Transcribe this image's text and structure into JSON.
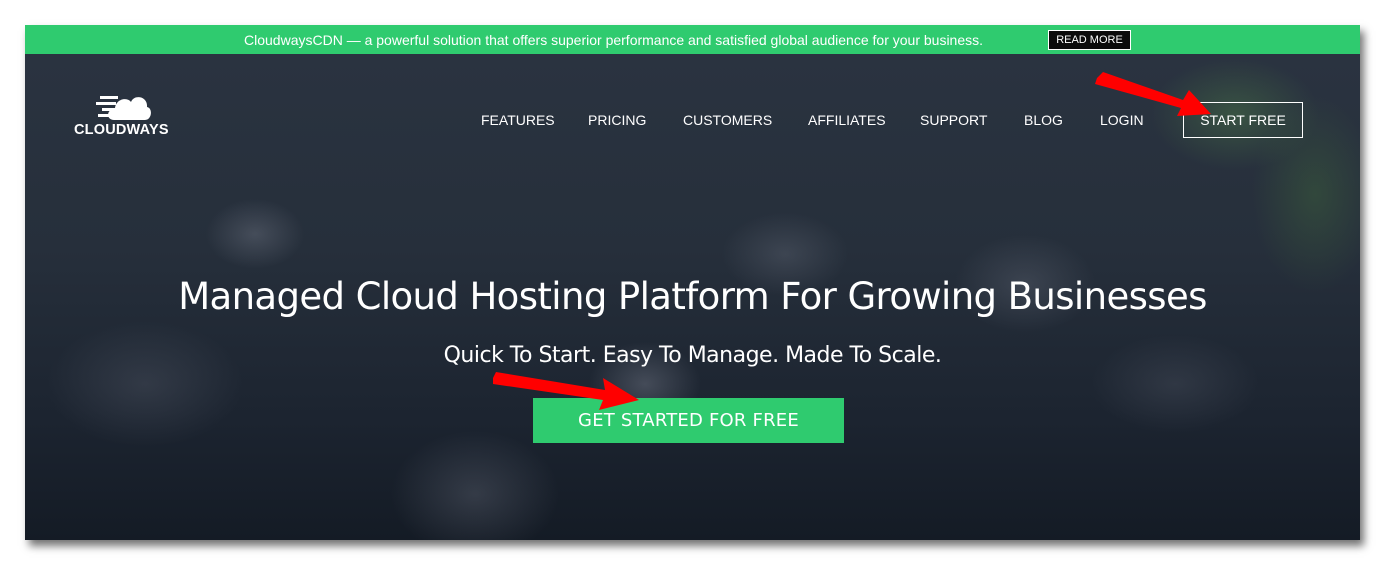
{
  "announcement": {
    "message": "CloudwaysCDN — a powerful solution that offers superior performance and satisfied global audience for your business.",
    "read_more_label": "READ MORE",
    "background_color": "#2fcb6f"
  },
  "header": {
    "logo_text": "CLOUDWAYS",
    "logo_icon": "cloud-speed-icon",
    "nav_items": [
      {
        "label": "FEATURES"
      },
      {
        "label": "PRICING"
      },
      {
        "label": "CUSTOMERS"
      },
      {
        "label": "AFFILIATES"
      },
      {
        "label": "SUPPORT"
      },
      {
        "label": "BLOG"
      },
      {
        "label": "LOGIN"
      }
    ],
    "start_free_label": "START FREE"
  },
  "hero": {
    "headline": "Managed Cloud Hosting Platform For Growing Businesses",
    "subheadline": "Quick To Start. Easy To Manage. Made To Scale.",
    "cta_label": "GET STARTED FOR FREE",
    "cta_color": "#2fcb6f"
  },
  "annotations": {
    "arrow_color": "#ff0000",
    "arrows": [
      {
        "points_to": "start-free-button"
      },
      {
        "points_to": "get-started-button"
      }
    ]
  }
}
